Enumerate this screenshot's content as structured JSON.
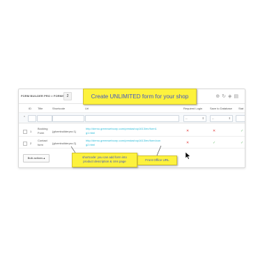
{
  "header": {
    "title": "FORM BUILDER PRO > FORMS",
    "count": "2",
    "toolbar_icons": [
      "add-icon",
      "refresh-icon",
      "sql-icon",
      "database-icon"
    ]
  },
  "banner": {
    "text": "Create UNLIMITED form for your shop"
  },
  "columns": {
    "id": "ID",
    "title": "Title",
    "shortcode": "Shortcode",
    "url": "Url",
    "required_login": "Required Login",
    "save_db": "Save to Database",
    "status": "Stat"
  },
  "filters": {
    "required_login": "--",
    "save_db": "--"
  },
  "rows": [
    {
      "id": "1",
      "title_line1": "Booking",
      "title_line2": "Form",
      "shortcode": "{gformbuilderpro:1}",
      "url_line1": "http://demo.greenwebcorp.com/prestashop1613/en/form1",
      "url_line2": "g1.html",
      "required_login": "x",
      "save_db": "x",
      "status": "ok"
    },
    {
      "id": "2",
      "title_line1": "Contact",
      "title_line2": "form",
      "shortcode": "{gformbuilderpro:2}",
      "url_line1": "http://demo.greenwebcorp.com/prestashop1613/en/form/con",
      "url_line2": "g2.html",
      "required_login": "x",
      "save_db": "ok",
      "status": "ok"
    }
  ],
  "bulk_actions": "Bulk actions ▴",
  "note_shortcode": {
    "line1": "shortcode: you can add form into",
    "line2": "product description & cms page"
  },
  "note_url": {
    "text": "Front Office URL"
  },
  "colors": {
    "banner_bg": "#fdf23d",
    "banner_text": "#4055c4",
    "link": "#25b9d7",
    "no": "#e23b3b",
    "yes": "#72c279"
  }
}
